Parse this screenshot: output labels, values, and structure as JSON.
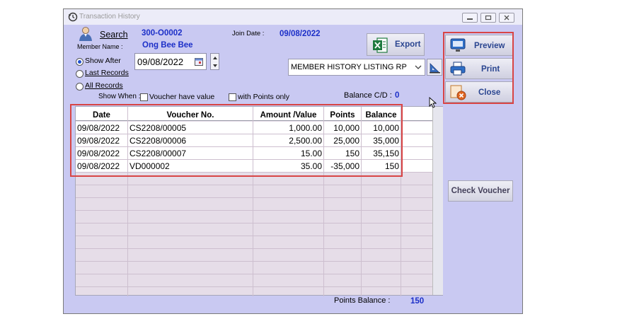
{
  "window": {
    "title": "Transaction History"
  },
  "member": {
    "search_label": "Search",
    "member_name_label": "Member Name :",
    "member_id": "300-O0002",
    "member_name": "Ong Bee Bee",
    "join_date_label": "Join Date :",
    "join_date": "09/08/2022"
  },
  "filters": {
    "show_after_label": "Show After",
    "last_records_label": "Last Records",
    "all_records_label": "All Records",
    "selected": "Show After",
    "date_value": "09/08/2022",
    "show_when_label": "Show When :",
    "voucher_have_value_label": "Voucher have value",
    "with_points_only_label": "with Points only"
  },
  "report": {
    "export_label": "Export",
    "report_select_value": "MEMBER HISTORY LISTING RP",
    "balance_cd_label": "Balance C/D :",
    "balance_cd_value": "0"
  },
  "side_buttons": {
    "preview_label": "Preview",
    "print_label": "Print",
    "close_label": "Close",
    "check_voucher_label": "Check Voucher"
  },
  "table": {
    "columns": [
      "Date",
      "Voucher No.",
      "Amount /Value",
      "Points",
      "Balance"
    ],
    "rows": [
      {
        "date": "09/08/2022",
        "voucher": "CS2208/00005",
        "amount": "1,000.00",
        "points": "10,000",
        "balance": "10,000"
      },
      {
        "date": "09/08/2022",
        "voucher": "CS2208/00006",
        "amount": "2,500.00",
        "points": "25,000",
        "balance": "35,000"
      },
      {
        "date": "09/08/2022",
        "voucher": "CS2208/00007",
        "amount": "15.00",
        "points": "150",
        "balance": "35,150"
      },
      {
        "date": "09/08/2022",
        "voucher": "VD000002",
        "amount": "35.00",
        "points": "-35,000",
        "balance": "150"
      }
    ]
  },
  "footer": {
    "points_balance_label": "Points Balance :",
    "points_balance_value": "150"
  },
  "colors": {
    "window_bg": "#c9c9f2",
    "value_blue": "#1c2fc8",
    "highlight_red": "#d84545",
    "grid_bg": "#e6dde8"
  }
}
